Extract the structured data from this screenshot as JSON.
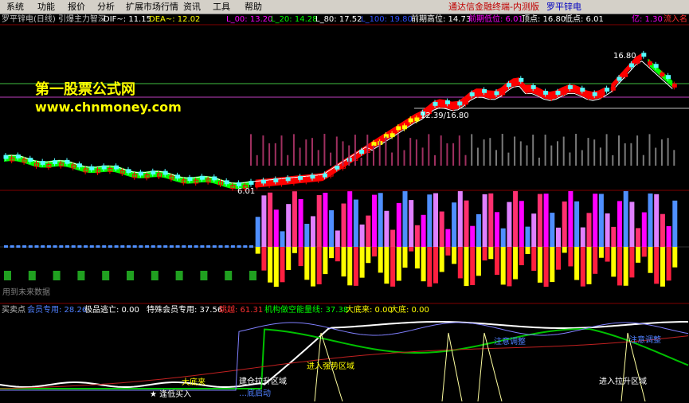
{
  "menu": {
    "items": [
      "系统",
      "功能",
      "报价",
      "分析",
      "扩展市场行情",
      "资讯",
      "工具",
      "帮助"
    ],
    "brand": "通达信金融终端-内测版",
    "stock": "罗平锌电"
  },
  "main_header": {
    "title": "罗平锌电(日线) 引爆主力智深",
    "dif": "DIF~: 11.15",
    "dea": "DEA~: 12.02",
    "l00": "L_00: 13.20",
    "l20": "L_20: 14.28",
    "l80": "L_80: 17.52",
    "l100": "L_100: 19.80",
    "prev_high": "前期高位: 14.73",
    "prev_low": "前期低位: 6.01",
    "top": "顶点: 16.80",
    "low": "低点: 6.01",
    "yi": "亿: 1.30",
    "inflow": "流入名"
  },
  "watermark": {
    "line1": "第一股票公式网",
    "line2": "www.chnmoney.com"
  },
  "price_marks": {
    "peak": "16.80",
    "trough": "6.01",
    "level": "12.39/16.80"
  },
  "sub_label": "用到未来数据",
  "indicator_header": {
    "name": "买卖点",
    "member": "会员专用: 28.26",
    "escape": "极品逃亡: 0.00",
    "special": "特殊会员专用: 37.56",
    "jump": "跳越: 61.31",
    "inst": "机构做空能量线: 37.38",
    "bottom_come": "大底来: 0.00",
    "bottom": "大底: 0.00"
  },
  "indicator_labels": {
    "zone_strong": "进入强势区域",
    "zone_rise": "进入拉升区域",
    "adjust1": "注意调整",
    "adjust2": "注意调整",
    "big_bottom": "大底来",
    "build": "建仓拉升区域",
    "low_buy": "★ 逢低买入",
    "follow": "…底启动"
  },
  "colors": {
    "up": "#ff0000",
    "down": "#54ffff",
    "yellow": "#ffff00",
    "green": "#00ff00",
    "magenta": "#ff00ff",
    "blue": "#4f8fff"
  }
}
